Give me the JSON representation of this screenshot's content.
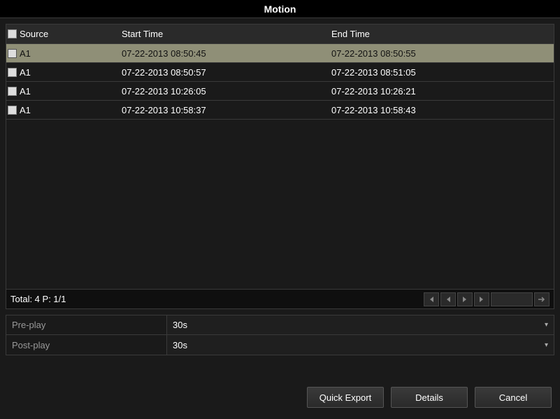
{
  "title": "Motion",
  "columns": {
    "source": "Source",
    "start": "Start Time",
    "end": "End Time"
  },
  "rows": [
    {
      "source": "A1",
      "start": "07-22-2013 08:50:45",
      "end": "07-22-2013 08:50:55",
      "selected": true
    },
    {
      "source": "A1",
      "start": "07-22-2013 08:50:57",
      "end": "07-22-2013 08:51:05",
      "selected": false
    },
    {
      "source": "A1",
      "start": "07-22-2013 10:26:05",
      "end": "07-22-2013 10:26:21",
      "selected": false
    },
    {
      "source": "A1",
      "start": "07-22-2013 10:58:37",
      "end": "07-22-2013 10:58:43",
      "selected": false
    }
  ],
  "status": "Total: 4  P: 1/1",
  "form": {
    "preplay_label": "Pre-play",
    "preplay_value": "30s",
    "postplay_label": "Post-play",
    "postplay_value": "30s"
  },
  "buttons": {
    "quick_export": "Quick Export",
    "details": "Details",
    "cancel": "Cancel"
  }
}
